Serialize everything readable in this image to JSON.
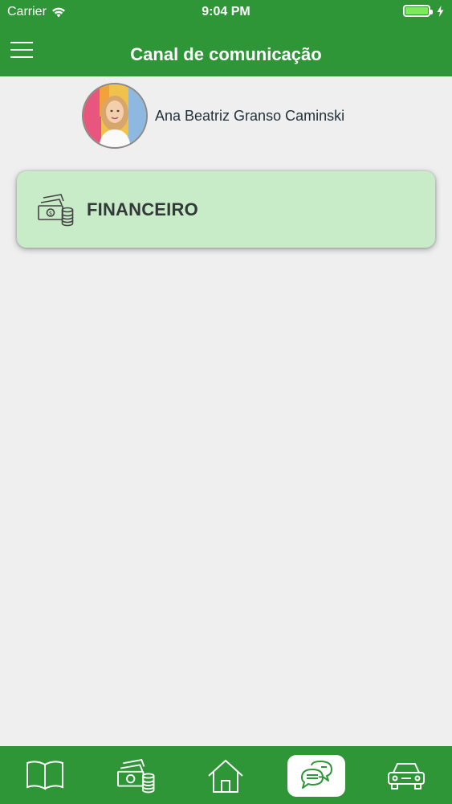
{
  "status_bar": {
    "carrier": "Carrier",
    "time": "9:04 PM"
  },
  "header": {
    "title": "Canal de comunicação"
  },
  "profile": {
    "name": "Ana Beatriz Granso Caminski"
  },
  "cards": [
    {
      "label": "FINANCEIRO",
      "icon": "money-icon"
    }
  ],
  "tabbar": {
    "tabs": [
      {
        "icon": "book-icon",
        "active": false
      },
      {
        "icon": "money-icon",
        "active": false
      },
      {
        "icon": "home-icon",
        "active": false
      },
      {
        "icon": "chat-icon",
        "active": true
      },
      {
        "icon": "car-icon",
        "active": false
      }
    ]
  },
  "colors": {
    "primary": "#2e9636",
    "card_bg": "#c8ecc7",
    "background": "#efefef"
  }
}
